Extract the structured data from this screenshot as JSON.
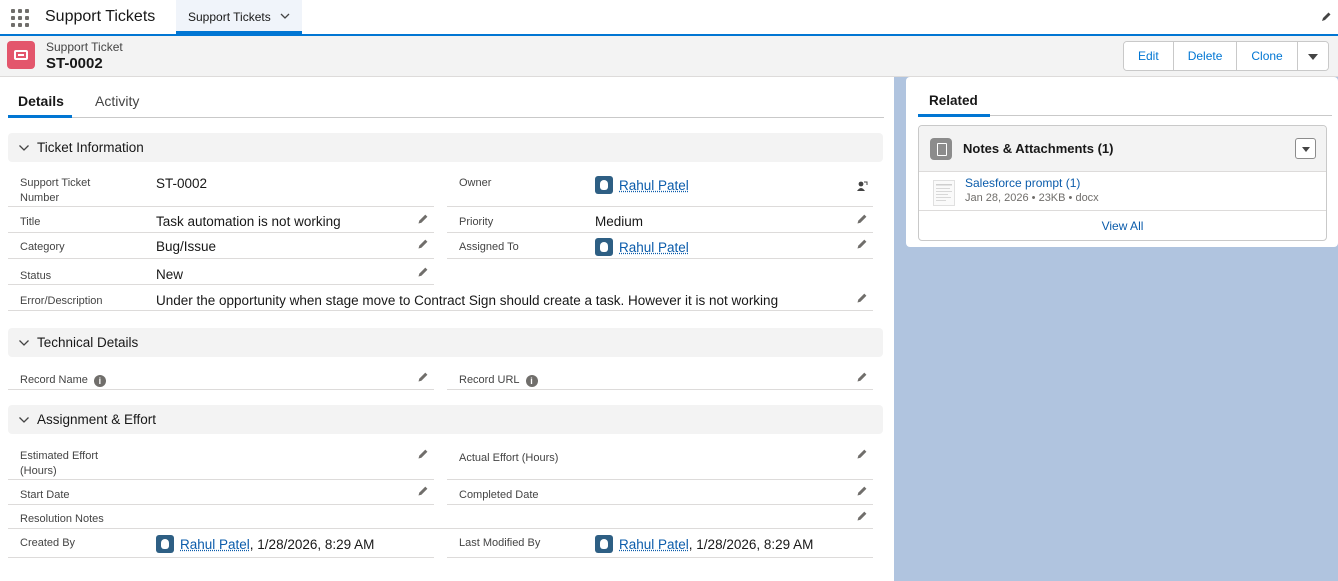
{
  "app": {
    "name": "Support Tickets"
  },
  "nav": {
    "tab_label": "Support Tickets"
  },
  "record": {
    "object_type": "Support Ticket",
    "name": "ST-0002",
    "actions": [
      "Edit",
      "Delete",
      "Clone"
    ]
  },
  "tabs": {
    "details": "Details",
    "activity": "Activity"
  },
  "sections": {
    "ticket_info": {
      "title": "Ticket Information",
      "support_ticket_number": {
        "label": "Support Ticket Number",
        "value": "ST-0002"
      },
      "owner": {
        "label": "Owner",
        "value": "Rahul Patel"
      },
      "title_field": {
        "label": "Title",
        "value": "Task automation is not working"
      },
      "priority": {
        "label": "Priority",
        "value": "Medium"
      },
      "category": {
        "label": "Category",
        "value": "Bug/Issue"
      },
      "assigned_to": {
        "label": "Assigned To",
        "value": "Rahul Patel"
      },
      "status": {
        "label": "Status",
        "value": "New"
      },
      "error_description": {
        "label": "Error/Description",
        "value": "Under the opportunity when stage move to Contract Sign should create a task. However it is not working"
      }
    },
    "technical": {
      "title": "Technical Details",
      "record_name": {
        "label": "Record Name",
        "value": ""
      },
      "record_url": {
        "label": "Record URL",
        "value": ""
      }
    },
    "assignment": {
      "title": "Assignment & Effort",
      "estimated_effort": {
        "label": "Estimated Effort (Hours)",
        "value": ""
      },
      "actual_effort": {
        "label": "Actual Effort (Hours)",
        "value": ""
      },
      "start_date": {
        "label": "Start Date",
        "value": ""
      },
      "completed_date": {
        "label": "Completed Date",
        "value": ""
      },
      "resolution_notes": {
        "label": "Resolution Notes",
        "value": ""
      },
      "created_by": {
        "label": "Created By",
        "user": "Rahul Patel",
        "date": ", 1/28/2026, 8:29 AM"
      },
      "last_modified_by": {
        "label": "Last Modified By",
        "user": "Rahul Patel",
        "date": ", 1/28/2026, 8:29 AM"
      }
    }
  },
  "related": {
    "tab": "Related",
    "notes": {
      "title": "Notes & Attachments (1)",
      "file_name": "Salesforce prompt (1)",
      "file_meta": "Jan 28, 2026 • 23KB • docx",
      "view_all": "View All"
    }
  },
  "colors": {
    "brand": "#0176d3",
    "record_icon": "#e3566c",
    "background": "#b0c4df"
  }
}
